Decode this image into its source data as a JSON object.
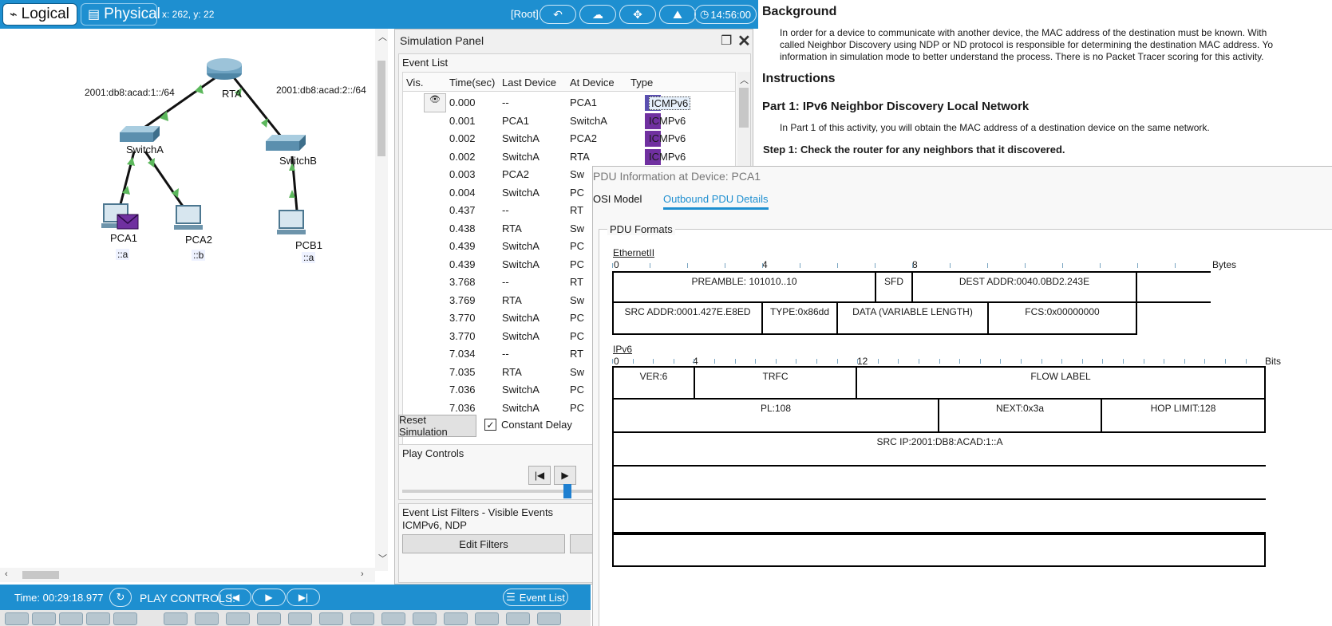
{
  "toolbar": {
    "logical_label": "Logical",
    "physical_label": "Physical",
    "coords": "x: 262, y: 22",
    "root_label": "[Root]",
    "clock": "14:56:00"
  },
  "topology": {
    "networks": [
      "2001:db8:acad:1::/64",
      "2001:db8:acad:2::/64"
    ],
    "devices": [
      {
        "name": "RTA",
        "ip": ""
      },
      {
        "name": "SwitchA",
        "ip": ""
      },
      {
        "name": "SwitchB",
        "ip": ""
      },
      {
        "name": "PCA1",
        "ip": "::a"
      },
      {
        "name": "PCA2",
        "ip": "::b"
      },
      {
        "name": "PCB1",
        "ip": "::a"
      }
    ]
  },
  "bottombar": {
    "time": "Time: 00:29:18.977",
    "play_controls_label": "PLAY CONTROLS:",
    "event_list_label": "Event List"
  },
  "simulation": {
    "title": "Simulation Panel",
    "event_list_label": "Event List",
    "columns": [
      "Vis.",
      "Time(sec)",
      "Last Device",
      "At Device",
      "Type"
    ],
    "events": [
      {
        "time": "0.000",
        "last": "--",
        "at": "PCA1",
        "type": "ICMPv6"
      },
      {
        "time": "0.001",
        "last": "PCA1",
        "at": "SwitchA",
        "type": "ICMPv6"
      },
      {
        "time": "0.002",
        "last": "SwitchA",
        "at": "PCA2",
        "type": "ICMPv6"
      },
      {
        "time": "0.002",
        "last": "SwitchA",
        "at": "RTA",
        "type": "ICMPv6"
      },
      {
        "time": "0.003",
        "last": "PCA2",
        "at": "Sw",
        "type": ""
      },
      {
        "time": "0.004",
        "last": "SwitchA",
        "at": "PC",
        "type": ""
      },
      {
        "time": "0.437",
        "last": "--",
        "at": "RT",
        "type": ""
      },
      {
        "time": "0.438",
        "last": "RTA",
        "at": "Sw",
        "type": ""
      },
      {
        "time": "0.439",
        "last": "SwitchA",
        "at": "PC",
        "type": ""
      },
      {
        "time": "0.439",
        "last": "SwitchA",
        "at": "PC",
        "type": ""
      },
      {
        "time": "3.768",
        "last": "--",
        "at": "RT",
        "type": ""
      },
      {
        "time": "3.769",
        "last": "RTA",
        "at": "Sw",
        "type": ""
      },
      {
        "time": "3.770",
        "last": "SwitchA",
        "at": "PC",
        "type": ""
      },
      {
        "time": "3.770",
        "last": "SwitchA",
        "at": "PC",
        "type": ""
      },
      {
        "time": "7.034",
        "last": "--",
        "at": "RT",
        "type": ""
      },
      {
        "time": "7.035",
        "last": "RTA",
        "at": "Sw",
        "type": ""
      },
      {
        "time": "7.036",
        "last": "SwitchA",
        "at": "PC",
        "type": ""
      },
      {
        "time": "7.036",
        "last": "SwitchA",
        "at": "PC",
        "type": ""
      }
    ],
    "reset_label": "Reset Simulation",
    "constant_delay_label": "Constant Delay",
    "constant_delay_checked": true,
    "play_controls_label": "Play Controls",
    "filters_label": "Event List Filters - Visible Events",
    "filters_value": "ICMPv6, NDP",
    "edit_filters_label": "Edit Filters"
  },
  "instructions": {
    "background_heading": "Background",
    "background_text": [
      "In order for a device to communicate with another device, the MAC address of the destination must be known. With",
      "called Neighbor Discovery using NDP or ND protocol is responsible for determining the destination MAC address. Yo",
      "information in simulation mode to better understand the process. There is no Packet Tracer scoring for this activity."
    ],
    "instructions_heading": "Instructions",
    "part1_heading": "Part 1: IPv6 Neighbor Discovery Local Network",
    "part1_text": "In Part 1 of this activity, you will obtain the MAC address of a destination device on the same network.",
    "step1_heading": "Step 1: Check the router for any neighbors that it discovered."
  },
  "pdu": {
    "title": "PDU Information at Device: PCA1",
    "tab_osi": "OSI Model",
    "tab_outbound": "Outbound PDU Details",
    "formats_label": "PDU Formats",
    "ethernet": {
      "title": "EthernetII",
      "scale": [
        "0",
        "4",
        "8"
      ],
      "unit": "Bytes",
      "row1": [
        "PREAMBLE: 101010..10",
        "SFD",
        "DEST ADDR:0040.0BD2.243E"
      ],
      "row2": [
        "SRC ADDR:0001.427E.E8ED",
        "TYPE:0x86dd",
        "DATA (VARIABLE LENGTH)",
        "FCS:0x00000000"
      ]
    },
    "ipv6": {
      "title": "IPv6",
      "scale": [
        "0",
        "4",
        "12"
      ],
      "unit": "Bits",
      "row1": [
        "VER:6",
        "TRFC",
        "FLOW LABEL"
      ],
      "row2": [
        "PL:108",
        "NEXT:0x3a",
        "HOP LIMIT:128"
      ],
      "row3": [
        "SRC IP:2001:DB8:ACAD:1::A"
      ]
    }
  }
}
